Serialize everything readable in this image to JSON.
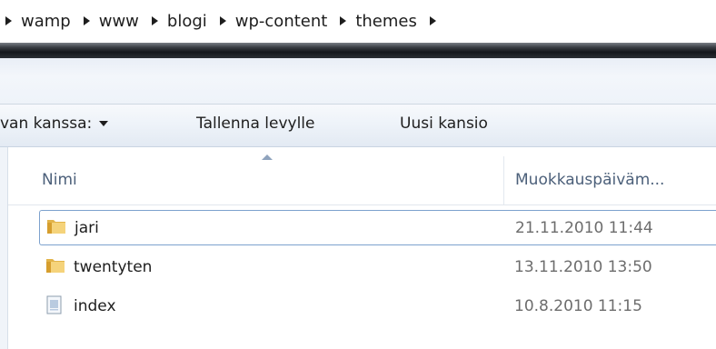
{
  "breadcrumb": [
    "wamp",
    "www",
    "blogi",
    "wp-content",
    "themes"
  ],
  "toolbar": {
    "share_label": "van kanssa:",
    "save_label": "Tallenna levylle",
    "new_folder_label": "Uusi kansio"
  },
  "columns": {
    "name": "Nimi",
    "date": "Muokkauspäiväm..."
  },
  "files": [
    {
      "name": "jari",
      "date": "21.11.2010 11:44",
      "type": "folder-icon"
    },
    {
      "name": "twentyten",
      "date": "13.11.2010 13:50",
      "type": "folder-icon"
    },
    {
      "name": "index",
      "date": "10.8.2010 11:15",
      "type": "file-icon"
    }
  ]
}
